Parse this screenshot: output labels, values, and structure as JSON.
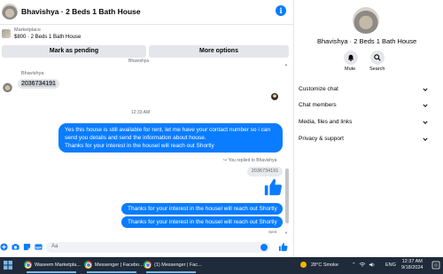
{
  "chat": {
    "header_title": "Bhavishya · 2 Beds 1 Bath House",
    "marketplace_label": "Marketplace",
    "listing_summary": "$800 · 2 Beds 1 Bath House",
    "mark_pending_label": "Mark as pending",
    "more_options_label": "More options",
    "cut_off_text": "Bhavishya",
    "incoming_sender": "Bhavishya",
    "incoming_message": "2036734191",
    "time_separator": "12:33 AM",
    "outgoing_long_lines": [
      "Yes this house is still available for rent, let me have your contact number so i can",
      "send you details and send the information about house.",
      "Thanks for your interest in the housel will reach out Shortly"
    ],
    "reply_note": "You replied to Bhavishya",
    "quoted_message": "2036734191",
    "outgoing_short_1": "Thanks for your interest in the housel will reach out Shortly",
    "outgoing_short_2": "Thanks for your interest in the housel will reach out Shortly",
    "sent_status": "Sent",
    "composer_placeholder": "Aa",
    "accent_color": "#0a7cff"
  },
  "panel": {
    "title": "Bhavishya · 2 Beds 1 Bath House",
    "mute_label": "Mute",
    "search_label": "Search",
    "sections": [
      "Customize chat",
      "Chat members",
      "Media, files and links",
      "Privacy & support"
    ]
  },
  "taskbar": {
    "items": [
      "Waseem Marketpla...",
      "Messenger | Facebo...",
      "(1) Messenger | Fac..."
    ],
    "weather": "28°C  Smoke",
    "language": "ENG",
    "time": "12:37 AM",
    "date": "9/18/2024"
  }
}
